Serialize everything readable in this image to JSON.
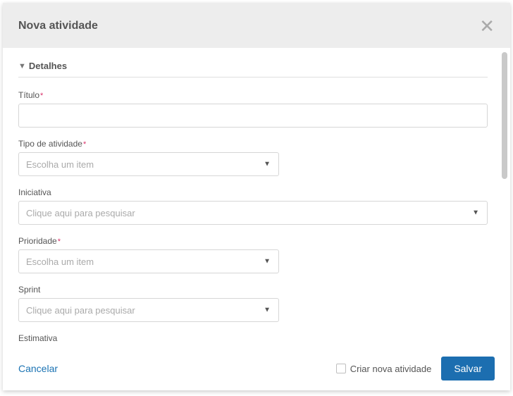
{
  "header": {
    "title": "Nova atividade"
  },
  "section": {
    "title": "Detalhes"
  },
  "fields": {
    "titulo": {
      "label": "Título"
    },
    "tipo": {
      "label": "Tipo de atividade",
      "placeholder": "Escolha um item"
    },
    "iniciativa": {
      "label": "Iniciativa",
      "placeholder": "Clique aqui para pesquisar"
    },
    "prioridade": {
      "label": "Prioridade",
      "placeholder": "Escolha um item"
    },
    "sprint": {
      "label": "Sprint",
      "placeholder": "Clique aqui para pesquisar"
    },
    "estimativa": {
      "label": "Estimativa"
    }
  },
  "footer": {
    "cancel": "Cancelar",
    "checkbox_label": "Criar nova atividade",
    "save": "Salvar"
  },
  "required_mark": "*"
}
